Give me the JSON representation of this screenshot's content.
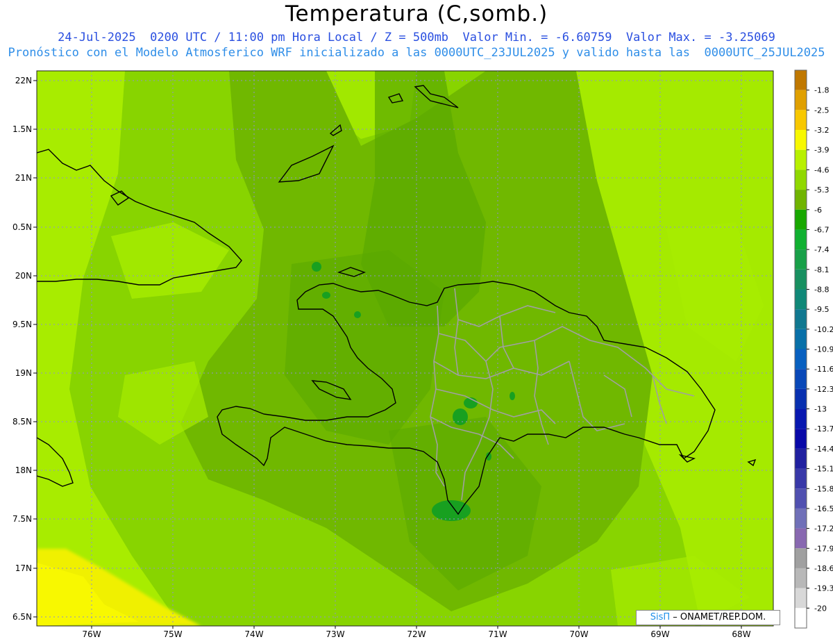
{
  "title": "Temperatura (C,somb.)",
  "subtitle_line1": "24-Jul-2025  0200 UTC / 11:00 pm Hora Local / Z = 500mb  Valor Min. = -6.60759  Valor Max. = -3.25069",
  "subtitle_line2": "Pronóstico con el Modelo Atmosferico WRF inicializado a las 0000UTC_23JUL2025 y valido hasta las  0000UTC_25JUL2025",
  "lat_ticks": [
    "22N",
    "1.5N",
    "21N",
    "0.5N",
    "20N",
    "9.5N",
    "19N",
    "8.5N",
    "18N",
    "7.5N",
    "17N",
    "6.5N"
  ],
  "lon_ticks": [
    "76W",
    "75W",
    "74W",
    "73W",
    "72W",
    "71W",
    "70W",
    "69W",
    "68W"
  ],
  "colorbar": {
    "labels": [
      "-1.8",
      "-2.5",
      "-3.2",
      "-3.9",
      "-4.6",
      "-5.3",
      "-6",
      "-6.7",
      "-7.4",
      "-8.1",
      "-8.8",
      "-9.5",
      "-10.2",
      "-10.9",
      "-11.6",
      "-12.3",
      "-13",
      "-13.7",
      "-14.4",
      "-15.1",
      "-15.8",
      "-16.5",
      "-17.2",
      "-17.9",
      "-18.6",
      "-19.3",
      "-20"
    ],
    "colors": [
      "#c07800",
      "#e0a000",
      "#f8c800",
      "#f8f800",
      "#b8f000",
      "#90d800",
      "#70b400",
      "#18a800",
      "#10b030",
      "#18a048",
      "#189060",
      "#108878",
      "#107890",
      "#0870a8",
      "#0860c0",
      "#0848b8",
      "#0830b0",
      "#0818b0",
      "#0808a8",
      "#2020a0",
      "#3838a8",
      "#5050b0",
      "#7070b8",
      "#8868b0",
      "#a0a0a0",
      "#b8b8b8",
      "#d8d8d8",
      "#ffffff"
    ]
  },
  "colors": {
    "field_light": "#a8ec00",
    "field_mid": "#88d400",
    "field_dark": "#70b800",
    "field_darker": "#5aa800",
    "yellow": "#f0f000",
    "dark_green": "#18a020",
    "coast": "#000000",
    "borders": "#a0a0a0",
    "grid": "#9090d0"
  },
  "credit": {
    "brand": "SisΠ",
    "org": " – ONAMET/REP.DOM."
  }
}
